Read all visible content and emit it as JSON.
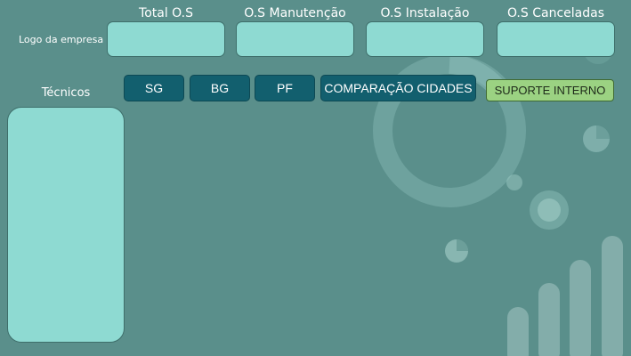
{
  "header": {
    "logo_text": "Logo da empresa",
    "kpis": [
      {
        "label": "Total O.S"
      },
      {
        "label": "O.S Manutenção"
      },
      {
        "label": "O.S Instalação"
      },
      {
        "label": "O.S Canceladas"
      }
    ]
  },
  "filters": {
    "buttons": [
      {
        "label": "SG"
      },
      {
        "label": "BG"
      },
      {
        "label": "PF"
      },
      {
        "label": "COMPARAÇÃO CIDADES"
      }
    ],
    "support_label": "SUPORTE INTERNO"
  },
  "sidebar": {
    "title": "Técnicos"
  },
  "colors": {
    "background": "#5a8f8b",
    "card": "#8edad2",
    "filter_button": "#125f6e",
    "support_button": "#9bd282"
  }
}
